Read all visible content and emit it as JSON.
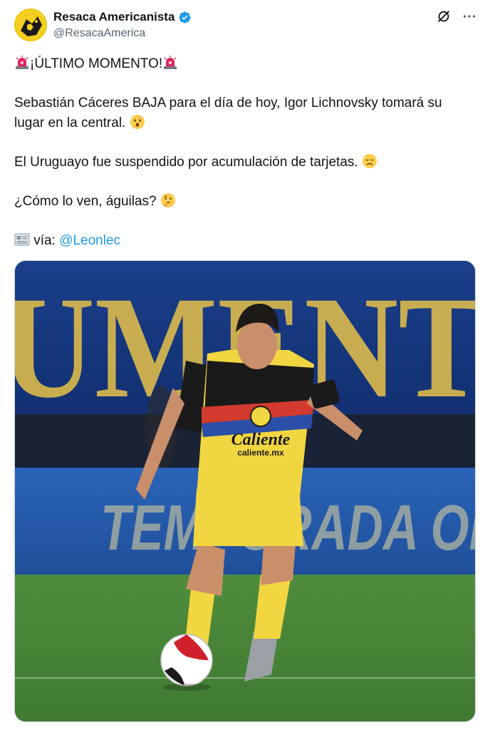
{
  "author": {
    "display_name": "Resaca Americanista",
    "handle": "@ResacaAmerica",
    "verified": true
  },
  "icons": {
    "avatar": "eagle-logo-avatar",
    "verified": "verified-badge-icon",
    "grok": "grok-icon",
    "more": "more-options-icon"
  },
  "tweet": {
    "headline": "¡ÚLTIMO MOMENTO!",
    "line1": "Sebastián Cáceres BAJA para el día de hoy, Igor Lichnovsky tomará su lugar en la central.",
    "line2": "El Uruguayo fue suspendido por acumulación de tarjetas.",
    "line3": "¿Cómo lo ven, águilas?",
    "via_label": "vía:",
    "via_link": "@Leonlec"
  },
  "media": {
    "banner_text": "UMENT",
    "board_text": "TEMPORADA OF",
    "jersey_sponsor": "Caliente",
    "jersey_sponsor_url": "caliente.mx"
  },
  "colors": {
    "link": "#1d9bf0",
    "verified": "#1d9bf0",
    "text": "#0f1419",
    "secondary": "#536471"
  }
}
